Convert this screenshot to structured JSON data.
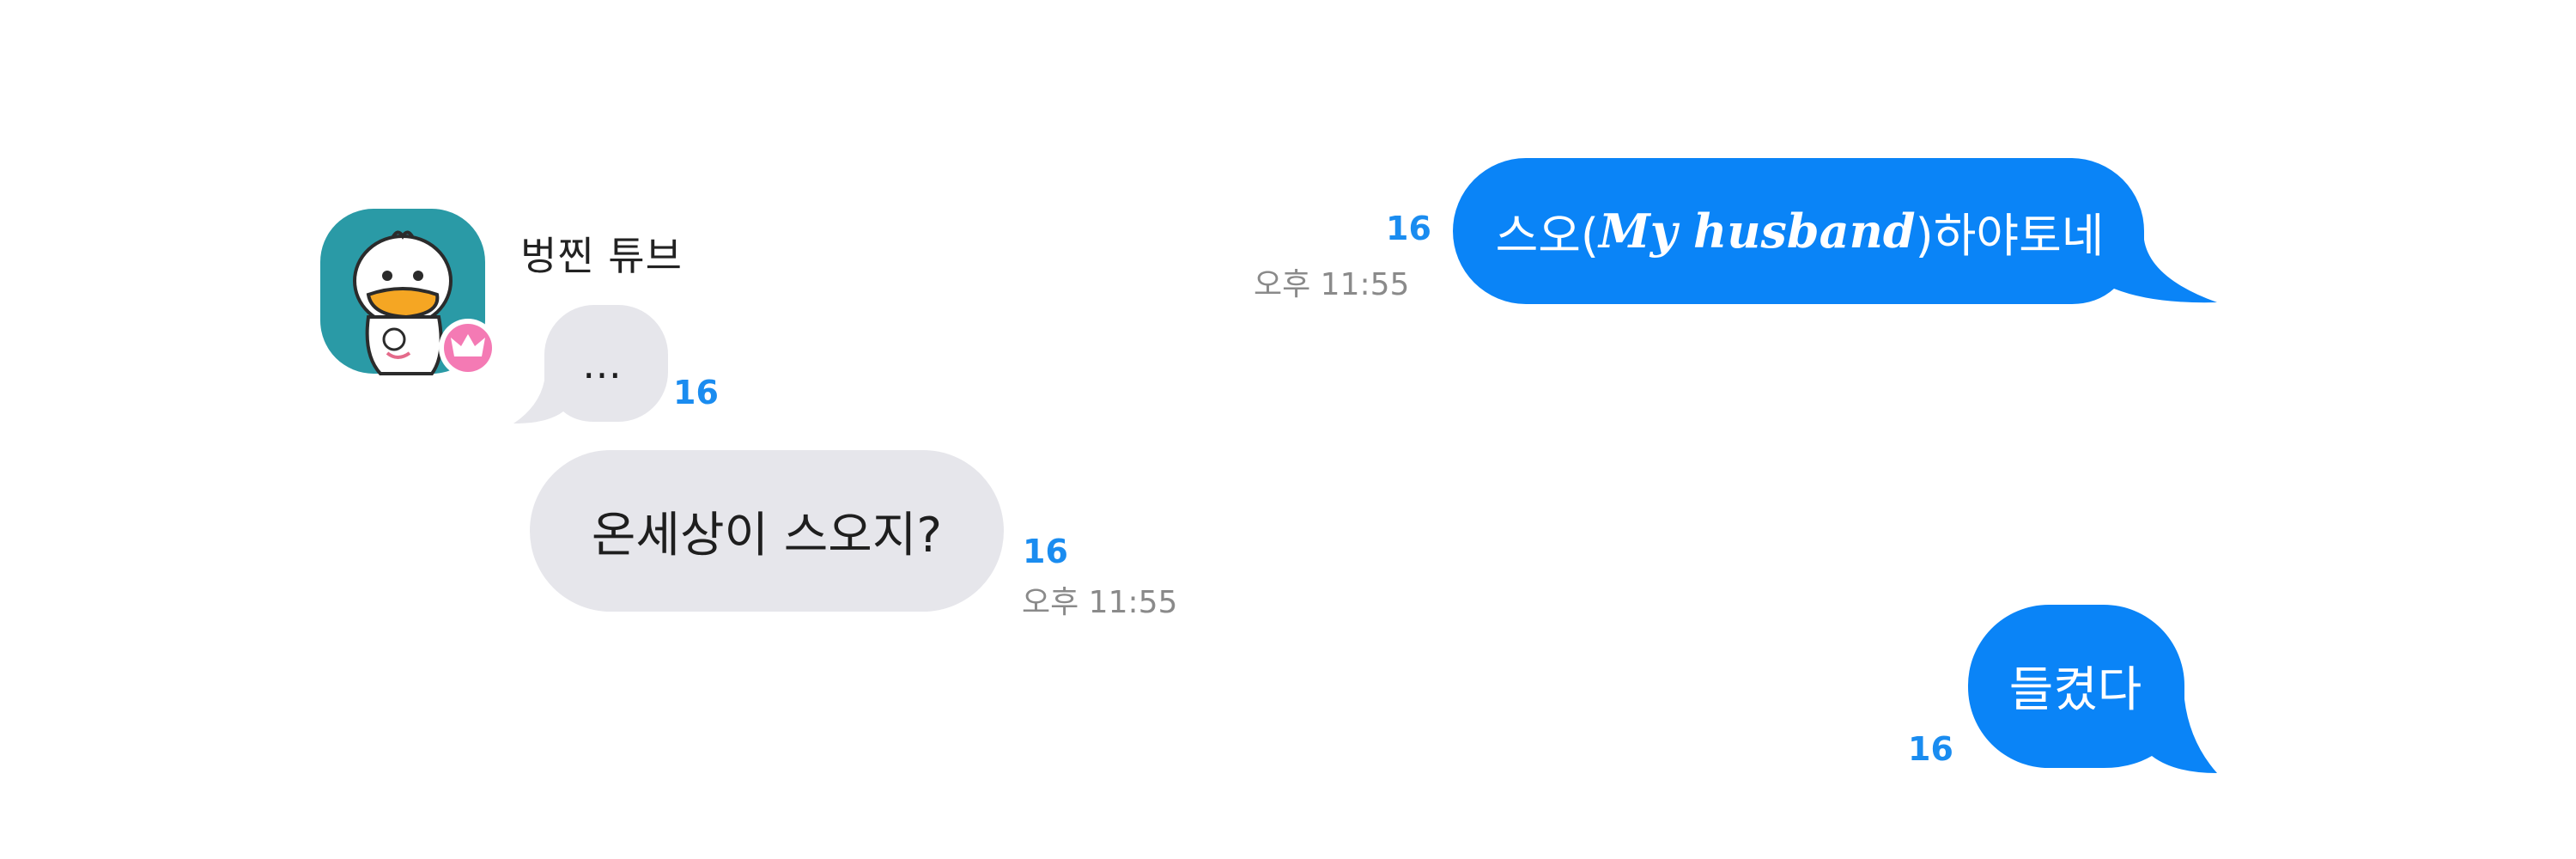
{
  "colors": {
    "outgoing_bubble": "#0a84f7",
    "incoming_bubble": "#e6e6eb",
    "unread_count": "#1a8cf0",
    "timestamp": "#8a8a8a",
    "avatar_background": "#2a9aa6",
    "badge": "#f47ab4"
  },
  "icons": {
    "avatar": "duck-character-avatar",
    "badge": "crown-icon"
  },
  "messages": [
    {
      "direction": "outgoing",
      "text_before": "스오(",
      "text_italic": "My husband",
      "text_after": ")하야토네",
      "unread_count": "16",
      "time": "오후 11:55"
    },
    {
      "direction": "incoming",
      "sender": "벙찐 튜브",
      "text": "…",
      "unread_count": "16"
    },
    {
      "direction": "incoming",
      "text": "온세상이 스오지?",
      "unread_count": "16",
      "time": "오후 11:55"
    },
    {
      "direction": "outgoing",
      "text": "들켰다",
      "unread_count": "16"
    }
  ]
}
